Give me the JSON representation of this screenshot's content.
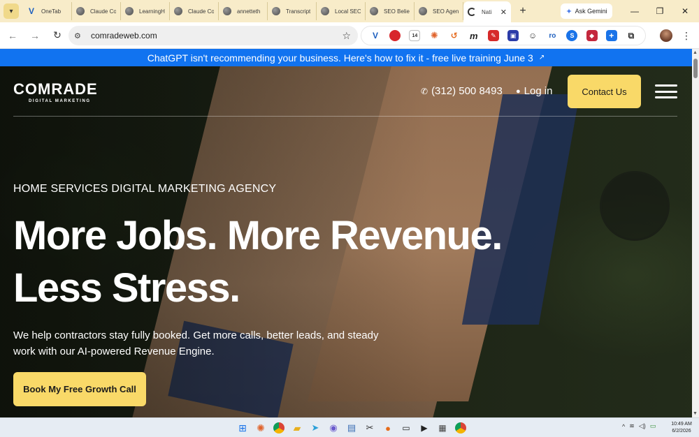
{
  "browser": {
    "tabs": [
      {
        "title": "OneTab",
        "icon": "onetab-v-icon"
      },
      {
        "title": "Claude Co",
        "icon": "globe-icon"
      },
      {
        "title": "LearningH",
        "icon": "globe-icon"
      },
      {
        "title": "Claude Co",
        "icon": "globe-icon"
      },
      {
        "title": "annetteth",
        "icon": "globe-icon"
      },
      {
        "title": "Transcript",
        "icon": "globe-icon"
      },
      {
        "title": "Local SEO",
        "icon": "globe-icon"
      },
      {
        "title": "SEO Belie",
        "icon": "globe-icon"
      },
      {
        "title": "SEO Agen",
        "icon": "globe-icon"
      },
      {
        "title": "Nati",
        "icon": "loading-icon",
        "active": true
      }
    ],
    "tab_close": "✕",
    "new_tab": "+",
    "ask_gemini": "Ask Gemini",
    "url": "comradeweb.com",
    "extension_badge": "14",
    "extension_labels": {
      "m": "m",
      "ro": "ro",
      "s": "S"
    }
  },
  "site": {
    "announcement": "ChatGPT isn't recommending your business. Here's how to fix it - free live training June 3",
    "announcement_arrow": "↗",
    "logo_main": "COMRADE",
    "logo_sub": "DIGITAL MARKETING",
    "phone": "(312) 500 8493",
    "login": "Log in",
    "contact_button": "Contact Us",
    "eyebrow": "HOME SERVICES DIGITAL MARKETING AGENCY",
    "headline_line1": "More Jobs. More Revenue.",
    "headline_line2": "Less Stress.",
    "subtext": "We help contractors stay fully booked. Get more calls, better leads, and steady work with our AI-powered Revenue Engine.",
    "cta_button": "Book My Free Growth Call"
  },
  "colors": {
    "announcement_bg": "#1173f0",
    "button_yellow": "#f9d968",
    "tabstrip_bg": "#f8ecc9"
  },
  "taskbar": {
    "time": "10:49 AM",
    "date": "6/2/2026"
  }
}
